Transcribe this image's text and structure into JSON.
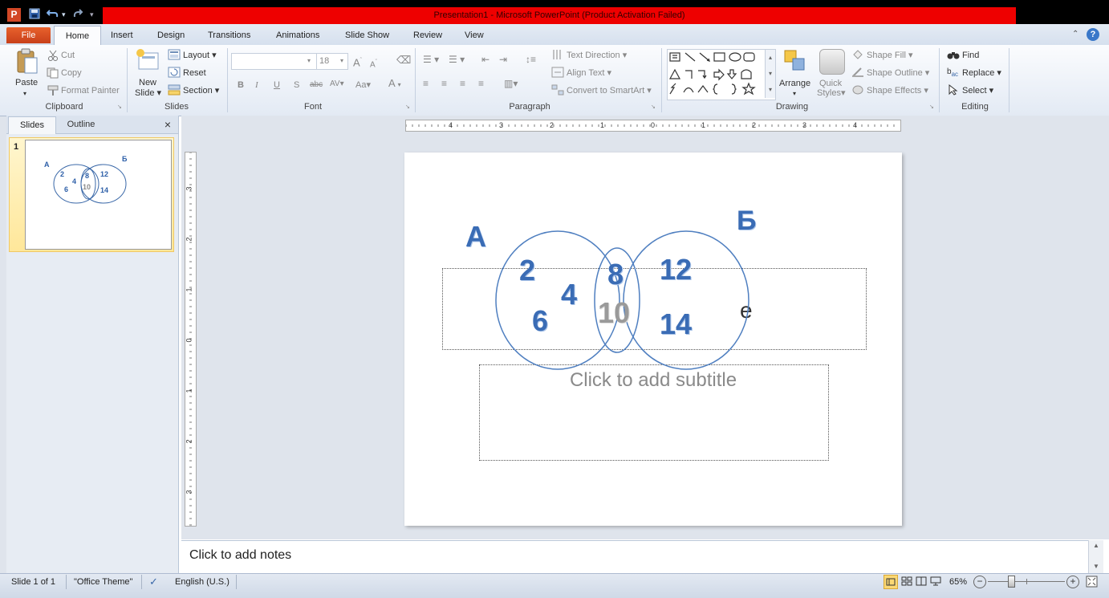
{
  "window": {
    "title": "Presentation1  -  Microsoft PowerPoint (Product Activation Failed)",
    "app_icon": "P"
  },
  "qat": {
    "save_icon": "save-icon",
    "undo_icon": "undo-icon",
    "redo_icon": "redo-icon"
  },
  "tabs": {
    "file": "File",
    "items": [
      "Home",
      "Insert",
      "Design",
      "Transitions",
      "Animations",
      "Slide Show",
      "Review",
      "View"
    ]
  },
  "ribbon": {
    "clipboard": {
      "paste": "Paste",
      "cut": "Cut",
      "copy": "Copy",
      "format_painter": "Format Painter",
      "label": "Clipboard"
    },
    "slides": {
      "new_slide_1": "New",
      "new_slide_2": "Slide",
      "layout": "Layout",
      "reset": "Reset",
      "section": "Section",
      "label": "Slides"
    },
    "font": {
      "font_size": "18",
      "bold": "B",
      "italic": "I",
      "underline": "U",
      "shadow": "S",
      "strike": "abc",
      "spacing": "AV",
      "case": "Aa",
      "color": "A",
      "label": "Font"
    },
    "paragraph": {
      "text_direction": "Text Direction",
      "align_text": "Align Text",
      "convert_smartart": "Convert to SmartArt",
      "label": "Paragraph"
    },
    "drawing": {
      "arrange": "Arrange",
      "quick_1": "Quick",
      "quick_2": "Styles",
      "shape_fill": "Shape Fill",
      "shape_outline": "Shape Outline",
      "shape_effects": "Shape Effects",
      "label": "Drawing"
    },
    "editing": {
      "find": "Find",
      "replace": "Replace",
      "select": "Select",
      "label": "Editing"
    }
  },
  "left_panel": {
    "slides_tab": "Slides",
    "outline_tab": "Outline",
    "close": "×",
    "slide_number": "1"
  },
  "ruler": {
    "h_labels": [
      "4",
      "3",
      "2",
      "1",
      "0",
      "1",
      "2",
      "3",
      "4"
    ],
    "v_labels": [
      "3",
      "2",
      "1",
      "0",
      "1",
      "2",
      "3"
    ]
  },
  "slide": {
    "title_partial": "e",
    "subtitle_placeholder": "Click to add subtitle",
    "venn": {
      "set_a_label": "А",
      "set_b_label": "Б",
      "a_only": [
        "2",
        "4",
        "6"
      ],
      "intersection": [
        "8",
        "10"
      ],
      "b_only": [
        "12",
        "14"
      ]
    }
  },
  "notes": {
    "placeholder": "Click to add notes"
  },
  "status": {
    "slide_info": "Slide 1 of 1",
    "theme": "\"Office Theme\"",
    "language": "English (U.S.)",
    "zoom": "65%"
  },
  "colors": {
    "venn_stroke": "#3a68a8",
    "venn_text": "#2d5fa8",
    "ten_text": "#8c8c8c",
    "title_bar_red": "#ee0000",
    "file_tab": "#d24726"
  }
}
